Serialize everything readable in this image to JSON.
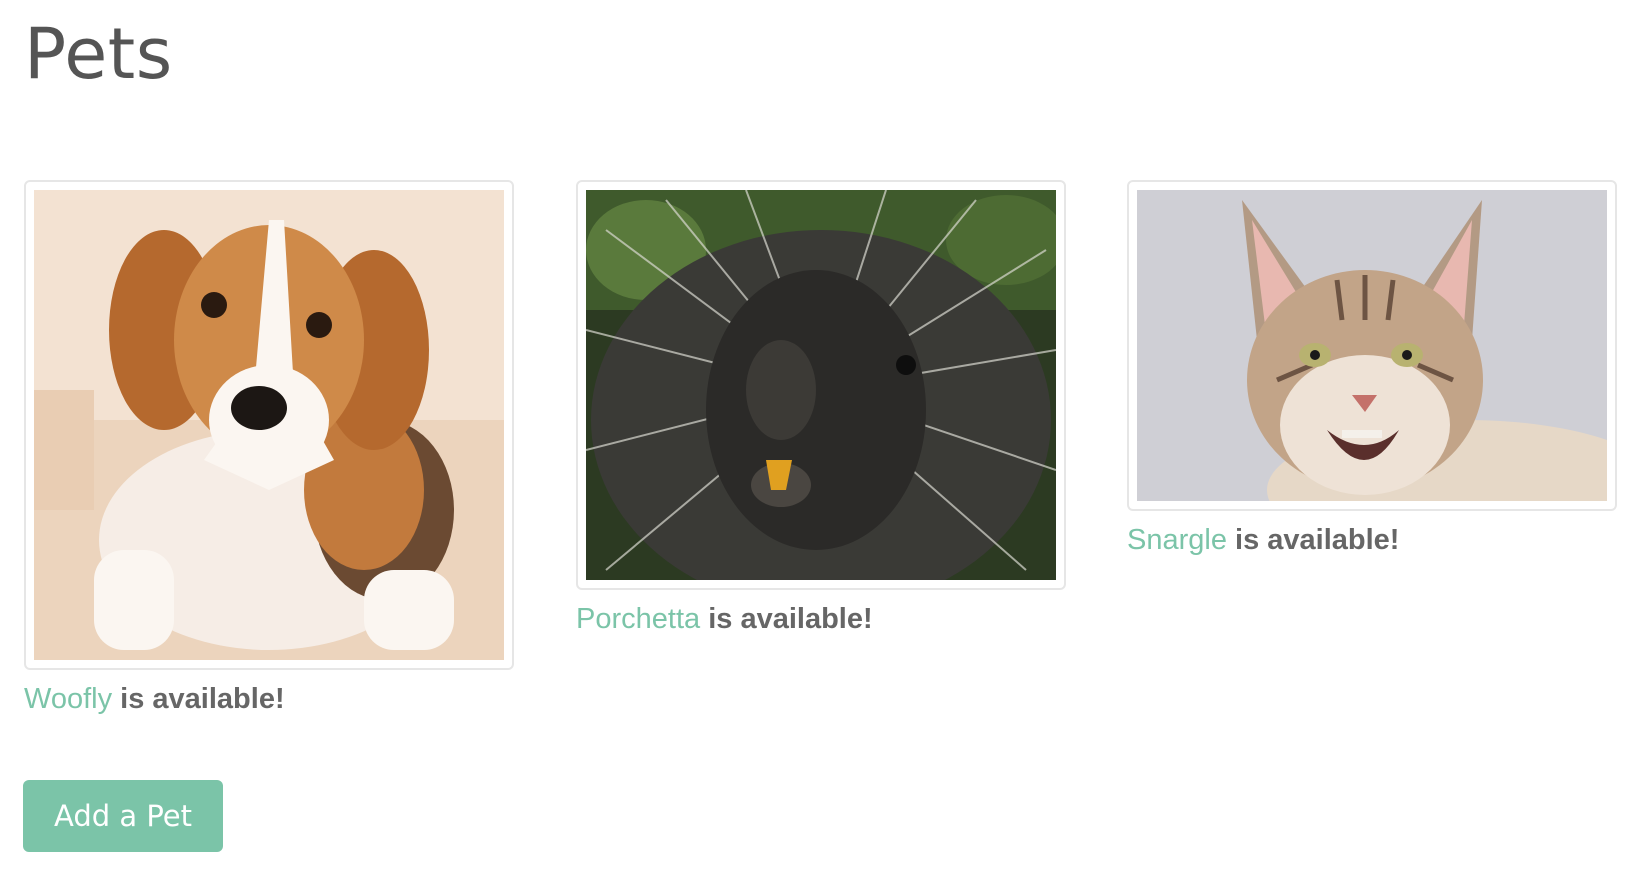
{
  "page": {
    "title": "Pets"
  },
  "pets": [
    {
      "name": "Woofly",
      "status": "is available!",
      "image": "beagle-photo"
    },
    {
      "name": "Porchetta",
      "status": "is available!",
      "image": "porcupine-photo"
    },
    {
      "name": "Snargle",
      "status": "is available!",
      "image": "maine-coon-cat-photo"
    }
  ],
  "actions": {
    "add_pet_label": "Add a Pet"
  },
  "colors": {
    "accent": "#7bc4a8",
    "title_text": "#555555",
    "status_text": "#666666",
    "card_border": "#e6e6e6"
  }
}
